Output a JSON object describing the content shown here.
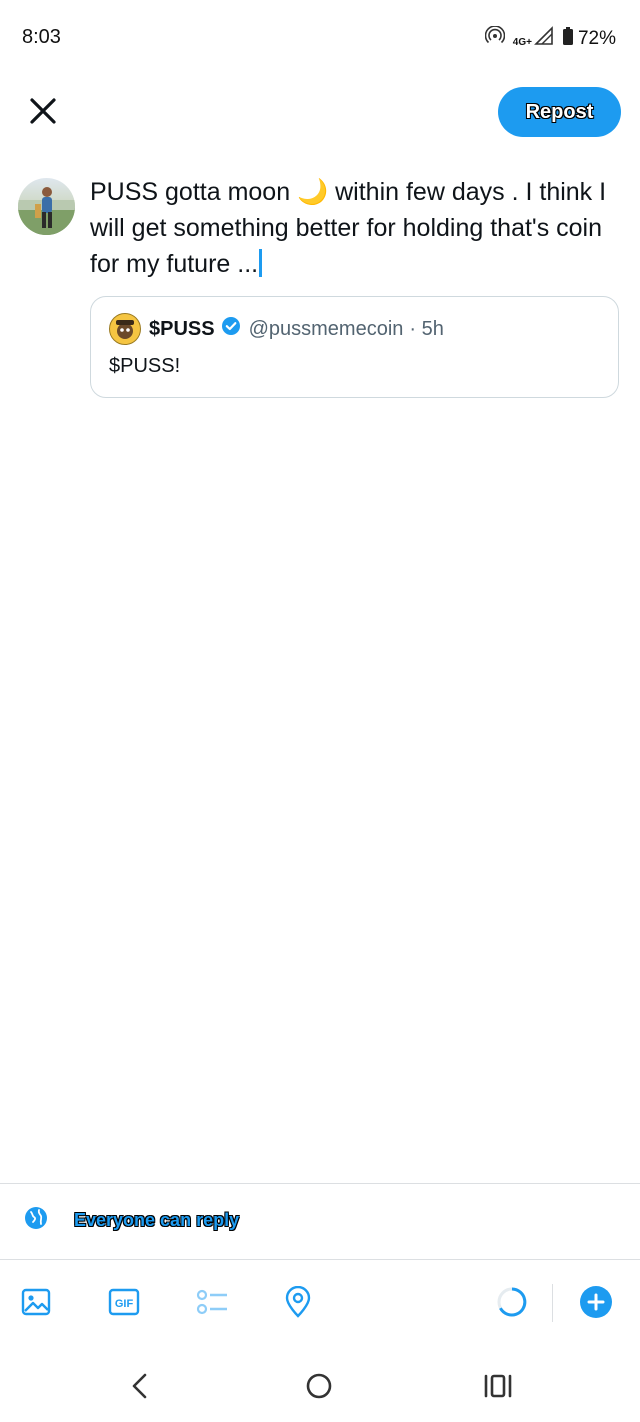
{
  "status_bar": {
    "time": "8:03",
    "network": "4G+",
    "battery": "72%"
  },
  "header": {
    "close_icon": "close-icon",
    "repost_label": "Repost"
  },
  "compose": {
    "text": "PUSS gotta moon 🌙 within few days . I think I will get something better for holding that's coin for my future ..."
  },
  "quote": {
    "name": "$PUSS",
    "handle": "@pussmemecoin",
    "time": "· 5h",
    "text": "$PUSS!"
  },
  "reply_setting": {
    "label": "Everyone can reply",
    "icon": "globe-icon"
  },
  "toolbar": {
    "items": [
      "image-icon",
      "gif-icon",
      "poll-icon",
      "location-icon",
      "char-counter-icon",
      "add-post-icon"
    ],
    "gif_label": "GIF"
  },
  "colors": {
    "accent": "#1d9bf0",
    "text": "#0f1419",
    "secondary": "#536471",
    "border": "#cfd9de"
  }
}
